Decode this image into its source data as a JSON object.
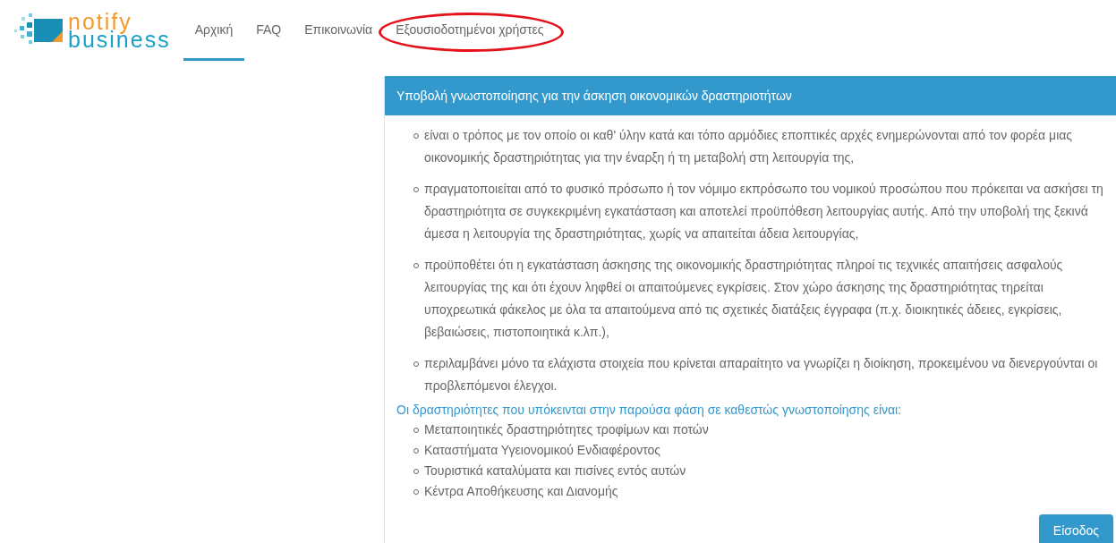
{
  "logo": {
    "line1": "notify",
    "line2": "business"
  },
  "nav": [
    {
      "label": "Αρχική",
      "selected": true,
      "circled": false
    },
    {
      "label": "FAQ",
      "selected": false,
      "circled": false
    },
    {
      "label": "Επικοινωνία",
      "selected": false,
      "circled": false
    },
    {
      "label": "Εξουσιοδοτημένοι χρήστες",
      "selected": false,
      "circled": true
    }
  ],
  "panel": {
    "title": "Υποβολή γνωστοποίησης για την άσκηση οικονομικών δραστηριοτήτων",
    "points": [
      "είναι ο τρόπος με τον οποίο οι καθ' ύλην κατά και τόπο αρμόδιες εποπτικές αρχές ενημερώνονται από τον φορέα μιας οικονομικής δραστηριότητας για την έναρξη ή τη μεταβολή στη λειτουργία της,",
      "πραγματοποιείται από το φυσικό πρόσωπο ή τον νόμιμο εκπρόσωπο του νομικού προσώπου που πρόκειται να ασκήσει τη δραστηριότητα σε συγκεκριμένη εγκατάσταση και αποτελεί προϋπόθεση λειτουργίας αυτής. Από την υποβολή της ξεκινά άμεσα η λειτουργία της δραστηριότητας, χωρίς να απαιτείται άδεια λειτουργίας,",
      "προϋποθέτει ότι η εγκατάσταση άσκησης της οικονομικής δραστηριότητας πληροί τις τεχνικές απαιτήσεις ασφαλούς λειτουργίας της και ότι έχουν ληφθεί οι απαιτούμενες εγκρίσεις. Στον χώρο άσκησης της δραστηριότητας τηρείται υποχρεωτικά φάκελος με όλα τα απαιτούμενα από τις σχετικές διατάξεις έγγραφα (π.χ. διοικητικές άδειες, εγκρίσεις, βεβαιώσεις, πιστοποιητικά κ.λπ.),",
      "περιλαμβάνει μόνο τα ελάχιστα στοιχεία που κρίνεται απαραίτητο να γνωρίζει η διοίκηση, προκειμένου να διενεργούνται οι προβλεπόμενοι έλεγχοι."
    ],
    "activities_heading": "Οι δραστηριότητες που υπόκεινται στην παρούσα φάση σε καθεστώς γνωστοποίησης είναι:",
    "activities": [
      "Μεταποιητικές δραστηριότητες τροφίμων και ποτών",
      "Καταστήματα Υγειονομικού Ενδιαφέροντος",
      "Τουριστικά καταλύματα και πισίνες εντός αυτών",
      "Κέντρα Αποθήκευσης και Διανομής"
    ],
    "login_button": "Είσοδος"
  }
}
